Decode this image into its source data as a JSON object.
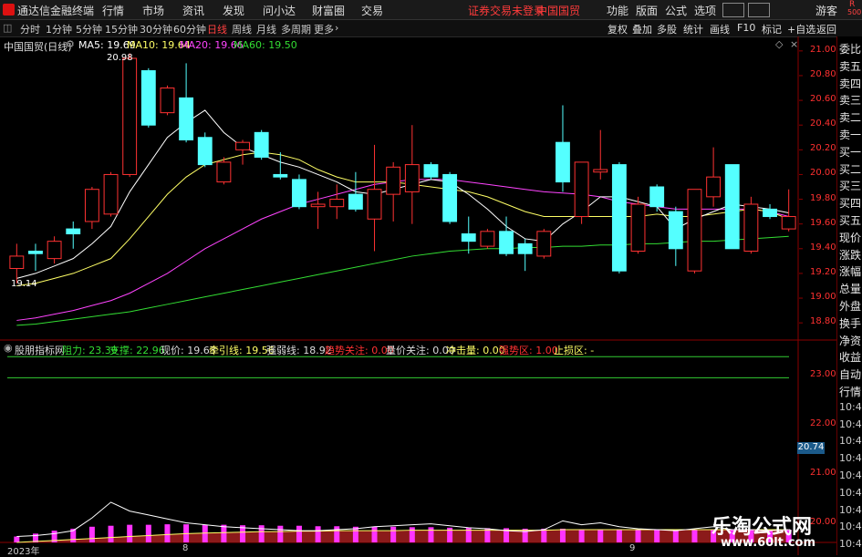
{
  "menubar": {
    "app_name": "通达信金融终端",
    "items": [
      "行情",
      "市场",
      "资讯",
      "发现",
      "问小达",
      "财富圈",
      "交易"
    ],
    "warning": "证券交易未登录",
    "stock_name": "中国国贸",
    "right_items": [
      "功能",
      "版面",
      "公式",
      "选项"
    ],
    "guest": "游客",
    "badge_r": "R",
    "badge_num": "500"
  },
  "periodbar": {
    "periods": [
      "分时",
      "1分钟",
      "5分钟",
      "15分钟",
      "30分钟",
      "60分钟",
      "日线",
      "周线",
      "月线",
      "多周期",
      "更多"
    ],
    "active": "日线",
    "tools": [
      "复权",
      "叠加",
      "多股",
      "统计",
      "画线",
      "F10",
      "标记",
      "+自选",
      "返回"
    ]
  },
  "main_header": {
    "stock": "中国国贸(日线)",
    "ma5_label": "MA5: 19.69",
    "ma10_label": "MA10: 19.64",
    "ma20_label": "MA20: 19.66",
    "ma60_label": "MA60: 19.50",
    "high_mark": "20.98",
    "low_mark": "19.14"
  },
  "price_axis": [
    "21.00",
    "20.80",
    "20.60",
    "20.40",
    "20.20",
    "20.00",
    "19.80",
    "19.60",
    "19.40",
    "19.20",
    "19.00",
    "18.80"
  ],
  "indicator_header": {
    "name": "股朋指标网",
    "resistance": "阻力: 23.39",
    "support": "支撑: 22.96",
    "price": "现价: 19.63",
    "pull": "牵引线: 19.56",
    "strong_weak": "强弱线: 18.92",
    "trend": "趋势关注: 0.00",
    "vol_price": "量价关注: 0.00",
    "impact": "冲击量: 0.00",
    "strong_zone": "强势区: 1.00",
    "stop_loss": "止损区: -"
  },
  "indicator_axis": [
    "23.00",
    "22.00",
    "21.00",
    "20.00"
  ],
  "indicator_value_box": "20.74",
  "date_axis": {
    "year": "2023年",
    "m8": "8",
    "m9": "9"
  },
  "side_panel": [
    "委比",
    "卖五",
    "卖四",
    "卖三",
    "卖二",
    "卖一",
    "买一",
    "买二",
    "买三",
    "买四",
    "买五",
    "现价",
    "涨跌",
    "涨幅",
    "总量",
    "外盘",
    "换手",
    "净资",
    "收益",
    "自动",
    "行情",
    "10:4",
    "10:4",
    "10:4",
    "10:4",
    "10:4",
    "10:4",
    "10:4",
    "10:4",
    "10:4"
  ],
  "watermark": {
    "line1": "乐淘公式网",
    "line2": "www.60lt.com"
  },
  "colors": {
    "up": "#ff3232",
    "down": "#54ffff",
    "ma5": "#ffffff",
    "ma10": "#ffff66",
    "ma20": "#ff44ff",
    "ma60": "#33dd33"
  },
  "chart_data": {
    "type": "candlestick",
    "ylim": [
      18.72,
      21.08
    ],
    "candles": [
      {
        "o": 19.24,
        "h": 19.44,
        "l": 19.12,
        "c": 19.34
      },
      {
        "o": 19.38,
        "h": 19.44,
        "l": 19.22,
        "c": 19.36
      },
      {
        "o": 19.32,
        "h": 19.5,
        "l": 19.28,
        "c": 19.46
      },
      {
        "o": 19.56,
        "h": 19.62,
        "l": 19.4,
        "c": 19.52
      },
      {
        "o": 19.62,
        "h": 19.9,
        "l": 19.56,
        "c": 19.88
      },
      {
        "o": 19.68,
        "h": 20.02,
        "l": 19.66,
        "c": 20.0
      },
      {
        "o": 20.0,
        "h": 20.98,
        "l": 19.98,
        "c": 20.94
      },
      {
        "o": 20.84,
        "h": 20.86,
        "l": 20.38,
        "c": 20.4
      },
      {
        "o": 20.5,
        "h": 20.72,
        "l": 20.48,
        "c": 20.7
      },
      {
        "o": 20.62,
        "h": 20.9,
        "l": 20.26,
        "c": 20.28
      },
      {
        "o": 20.3,
        "h": 20.34,
        "l": 20.06,
        "c": 20.08
      },
      {
        "o": 19.94,
        "h": 20.14,
        "l": 19.92,
        "c": 20.1
      },
      {
        "o": 20.2,
        "h": 20.28,
        "l": 20.08,
        "c": 20.26
      },
      {
        "o": 20.34,
        "h": 20.36,
        "l": 20.12,
        "c": 20.14
      },
      {
        "o": 20.0,
        "h": 20.18,
        "l": 19.96,
        "c": 19.98
      },
      {
        "o": 19.96,
        "h": 20.0,
        "l": 19.72,
        "c": 19.74
      },
      {
        "o": 19.74,
        "h": 19.86,
        "l": 19.56,
        "c": 19.76
      },
      {
        "o": 19.74,
        "h": 19.92,
        "l": 19.64,
        "c": 19.8
      },
      {
        "o": 19.84,
        "h": 20.02,
        "l": 19.7,
        "c": 19.72
      },
      {
        "o": 19.64,
        "h": 20.24,
        "l": 19.38,
        "c": 19.88
      },
      {
        "o": 19.84,
        "h": 20.1,
        "l": 19.62,
        "c": 20.06
      },
      {
        "o": 19.86,
        "h": 20.4,
        "l": 19.6,
        "c": 20.08
      },
      {
        "o": 20.08,
        "h": 20.1,
        "l": 19.96,
        "c": 19.98
      },
      {
        "o": 20.0,
        "h": 20.02,
        "l": 19.6,
        "c": 19.62
      },
      {
        "o": 19.52,
        "h": 19.66,
        "l": 19.36,
        "c": 19.46
      },
      {
        "o": 19.42,
        "h": 19.56,
        "l": 19.4,
        "c": 19.54
      },
      {
        "o": 19.54,
        "h": 19.66,
        "l": 19.34,
        "c": 19.36
      },
      {
        "o": 19.44,
        "h": 19.48,
        "l": 19.22,
        "c": 19.36
      },
      {
        "o": 19.34,
        "h": 19.56,
        "l": 19.32,
        "c": 19.54
      },
      {
        "o": 20.26,
        "h": 20.56,
        "l": 19.86,
        "c": 19.94
      },
      {
        "o": 19.66,
        "h": 20.1,
        "l": 19.6,
        "c": 20.1
      },
      {
        "o": 20.02,
        "h": 20.36,
        "l": 19.96,
        "c": 20.04
      },
      {
        "o": 20.08,
        "h": 20.1,
        "l": 19.2,
        "c": 19.22
      },
      {
        "o": 19.38,
        "h": 19.82,
        "l": 19.36,
        "c": 19.76
      },
      {
        "o": 19.9,
        "h": 19.92,
        "l": 19.7,
        "c": 19.74
      },
      {
        "o": 19.7,
        "h": 19.74,
        "l": 19.26,
        "c": 19.4
      },
      {
        "o": 19.22,
        "h": 19.88,
        "l": 19.2,
        "c": 19.88
      },
      {
        "o": 19.82,
        "h": 20.22,
        "l": 19.74,
        "c": 19.98
      },
      {
        "o": 20.08,
        "h": 20.08,
        "l": 19.4,
        "c": 19.4
      },
      {
        "o": 19.38,
        "h": 19.82,
        "l": 19.36,
        "c": 19.76
      },
      {
        "o": 19.72,
        "h": 19.76,
        "l": 19.64,
        "c": 19.66
      },
      {
        "o": 19.56,
        "h": 19.88,
        "l": 19.54,
        "c": 19.66
      }
    ],
    "ma5": [
      19.16,
      19.2,
      19.26,
      19.32,
      19.44,
      19.58,
      19.86,
      20.08,
      20.3,
      20.42,
      20.52,
      20.34,
      20.22,
      20.16,
      20.1,
      20.06,
      20.0,
      19.94,
      19.86,
      19.84,
      19.88,
      19.92,
      19.96,
      19.94,
      19.84,
      19.72,
      19.58,
      19.48,
      19.46,
      19.6,
      19.7,
      19.82,
      19.82,
      19.78,
      19.74,
      19.56,
      19.64,
      19.7,
      19.76,
      19.74,
      19.72,
      19.69
    ],
    "ma10": [
      19.1,
      19.12,
      19.16,
      19.2,
      19.26,
      19.32,
      19.48,
      19.66,
      19.84,
      19.98,
      20.08,
      20.12,
      20.16,
      20.18,
      20.16,
      20.12,
      20.04,
      19.98,
      19.94,
      19.94,
      19.94,
      19.92,
      19.9,
      19.88,
      19.86,
      19.82,
      19.76,
      19.7,
      19.66,
      19.66,
      19.66,
      19.66,
      19.66,
      19.66,
      19.68,
      19.66,
      19.66,
      19.68,
      19.7,
      19.72,
      19.7,
      19.64
    ],
    "ma20": [
      18.82,
      18.84,
      18.87,
      18.9,
      18.94,
      18.98,
      19.04,
      19.12,
      19.2,
      19.3,
      19.4,
      19.48,
      19.56,
      19.64,
      19.7,
      19.76,
      19.8,
      19.84,
      19.88,
      19.92,
      19.94,
      19.96,
      19.96,
      19.96,
      19.94,
      19.92,
      19.9,
      19.88,
      19.86,
      19.85,
      19.84,
      19.82,
      19.78,
      19.76,
      19.74,
      19.72,
      19.72,
      19.72,
      19.72,
      19.72,
      19.7,
      19.66
    ],
    "ma60": [
      18.78,
      18.79,
      18.81,
      18.83,
      18.85,
      18.87,
      18.89,
      18.92,
      18.95,
      18.98,
      19.01,
      19.04,
      19.07,
      19.1,
      19.13,
      19.16,
      19.19,
      19.22,
      19.25,
      19.28,
      19.31,
      19.34,
      19.36,
      19.38,
      19.39,
      19.4,
      19.4,
      19.41,
      19.41,
      19.42,
      19.42,
      19.43,
      19.43,
      19.44,
      19.44,
      19.45,
      19.46,
      19.46,
      19.47,
      19.48,
      19.49,
      19.5
    ],
    "indicator": {
      "ylim": [
        19.6,
        23.6
      ],
      "resistance": 23.39,
      "support": 22.96,
      "white_line": [
        19.72,
        19.74,
        19.78,
        19.84,
        20.1,
        20.42,
        20.24,
        20.16,
        20.08,
        20.0,
        19.96,
        19.92,
        19.9,
        19.88,
        19.86,
        19.84,
        19.84,
        19.86,
        19.88,
        19.92,
        19.94,
        19.96,
        19.98,
        19.94,
        19.9,
        19.88,
        19.84,
        19.82,
        19.86,
        20.04,
        19.96,
        20.0,
        19.92,
        19.88,
        19.86,
        19.84,
        19.88,
        19.92,
        19.86,
        19.86,
        19.84,
        19.86
      ],
      "yellow_line": [
        19.6,
        19.62,
        19.64,
        19.66,
        19.68,
        19.7,
        19.72,
        19.74,
        19.76,
        19.78,
        19.79,
        19.8,
        19.81,
        19.82,
        19.82,
        19.83,
        19.83,
        19.84,
        19.84,
        19.84,
        19.84,
        19.85,
        19.85,
        19.85,
        19.85,
        19.85,
        19.85,
        19.85,
        19.85,
        19.86,
        19.86,
        19.86,
        19.86,
        19.86,
        19.86,
        19.86,
        19.86,
        19.86,
        19.86,
        19.86,
        19.86,
        19.86
      ],
      "bars": [
        19.72,
        19.78,
        19.84,
        19.88,
        19.92,
        19.94,
        19.96,
        19.96,
        19.97,
        19.97,
        19.96,
        19.96,
        19.95,
        19.95,
        19.94,
        19.94,
        19.93,
        19.93,
        19.92,
        19.92,
        19.92,
        19.91,
        19.91,
        19.9,
        19.9,
        19.89,
        19.89,
        19.88,
        19.88,
        19.88,
        19.87,
        19.87,
        19.87,
        19.86,
        19.86,
        19.86,
        19.86,
        19.86,
        19.86,
        19.86,
        19.86,
        19.86
      ]
    }
  }
}
